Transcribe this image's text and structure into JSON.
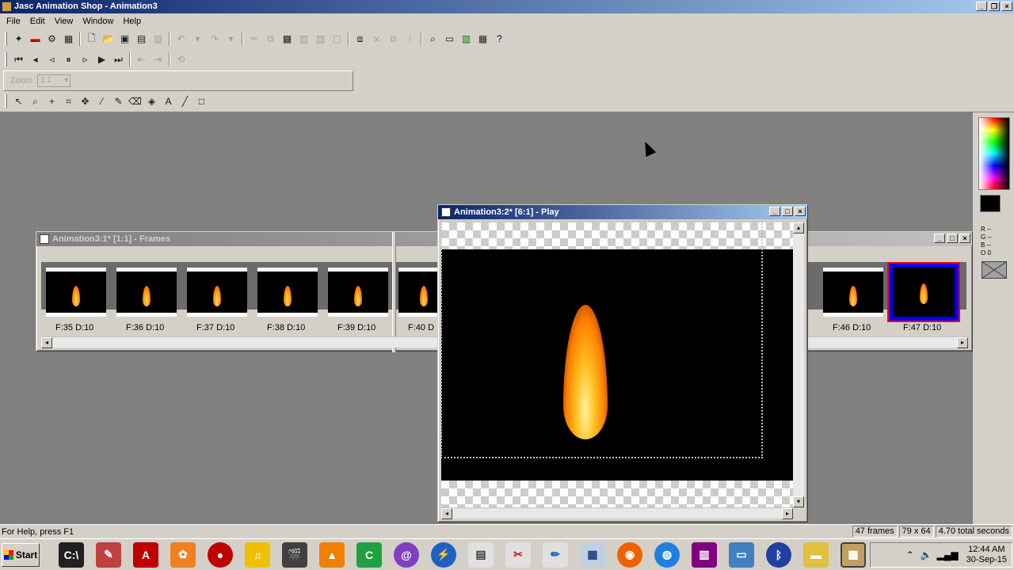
{
  "window": {
    "title": "Jasc Animation Shop - Animation3"
  },
  "menu": [
    "File",
    "Edit",
    "View",
    "Window",
    "Help"
  ],
  "toolbar": {
    "zoom_label": "Zoom",
    "zoom_value": "1:1"
  },
  "frames_window": {
    "title": "Animation3:1* [1:1] - Frames",
    "frames": [
      {
        "label": "F:35  D:10"
      },
      {
        "label": "F:36  D:10"
      },
      {
        "label": "F:37  D:10"
      },
      {
        "label": "F:38  D:10"
      },
      {
        "label": "F:39  D:10"
      },
      {
        "label": "F:40  D"
      },
      {
        "label": "F:46  D:10"
      },
      {
        "label": "F:47  D:10"
      }
    ]
  },
  "play_window": {
    "title": "Animation3:2* [6:1] - Play"
  },
  "palette": {
    "rgb": [
      "R --",
      "G --",
      "B --",
      "O 0"
    ]
  },
  "status": {
    "help": "For Help, press F1",
    "frames": "47 frames",
    "size": "79 x 64",
    "duration": "4.70 total seconds"
  },
  "taskbar": {
    "start_label": "Start",
    "time": "12:44 AM",
    "date": "30-Sep-15"
  },
  "colors": {
    "selection_border": "#0000ff",
    "title_active": "#0a246a"
  }
}
